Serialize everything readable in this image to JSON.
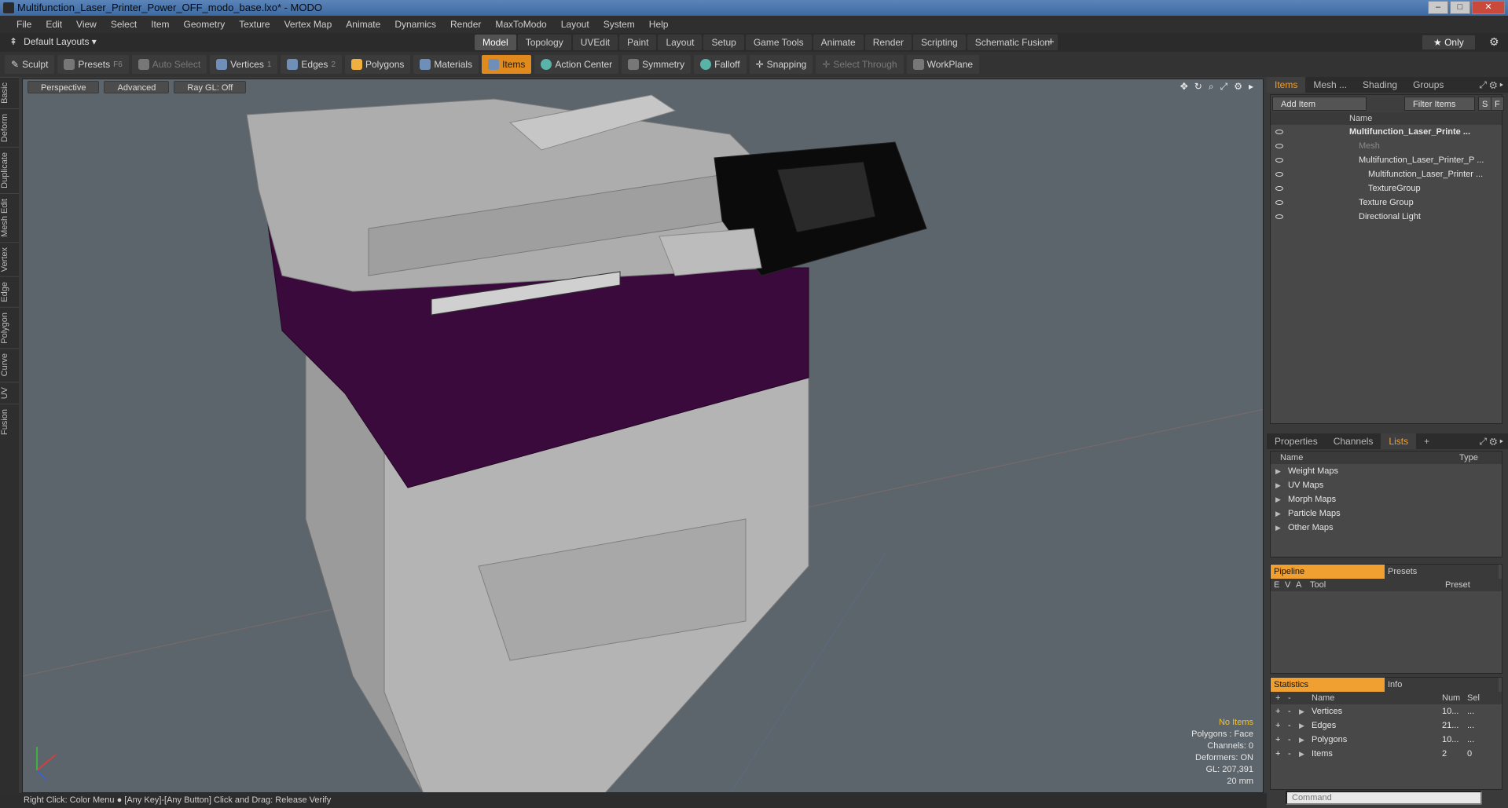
{
  "window": {
    "title": "Multifunction_Laser_Printer_Power_OFF_modo_base.lxo* - MODO",
    "min": "–",
    "max": "□",
    "close": "✕"
  },
  "menubar": [
    "File",
    "Edit",
    "View",
    "Select",
    "Item",
    "Geometry",
    "Texture",
    "Vertex Map",
    "Animate",
    "Dynamics",
    "Render",
    "MaxToModo",
    "Layout",
    "System",
    "Help"
  ],
  "layoutbar": {
    "layouts_label": "Default Layouts ▾",
    "tabs": [
      "Model",
      "Topology",
      "UVEdit",
      "Paint",
      "Layout",
      "Setup",
      "Game Tools",
      "Animate",
      "Render",
      "Scripting",
      "Schematic Fusion"
    ],
    "active_tab": "Model",
    "plus": "+",
    "only": "★ Only"
  },
  "toolbar": {
    "sculpt": "Sculpt",
    "presets": "Presets",
    "presets_key": "F6",
    "auto_select": "Auto Select",
    "vertices": "Vertices",
    "vertices_key": "1",
    "edges": "Edges",
    "edges_key": "2",
    "polygons": "Polygons",
    "materials": "Materials",
    "items": "Items",
    "action_center": "Action Center",
    "symmetry": "Symmetry",
    "falloff": "Falloff",
    "snapping": "Snapping",
    "select_through": "Select Through",
    "workplane": "WorkPlane"
  },
  "leftstrip": [
    "Basic",
    "Deform",
    "Duplicate",
    "Mesh Edit",
    "Vertex",
    "Edge",
    "Polygon",
    "Curve",
    "UV",
    "Fusion"
  ],
  "viewport": {
    "perspective": "Perspective",
    "advanced": "Advanced",
    "raygl": "Ray GL: Off",
    "stats": {
      "no_items": "No Items",
      "polygons": "Polygons : Face",
      "channels": "Channels: 0",
      "deformers": "Deformers: ON",
      "gl": "GL: 207,391",
      "size": "20 mm"
    }
  },
  "statusbar": "Right Click: Color Menu ● [Any Key]-[Any Button] Click and Drag: Release Verify",
  "items_panel": {
    "tabs": [
      "Items",
      "Mesh ...",
      "Shading",
      "Groups"
    ],
    "add_item": "Add Item",
    "filter_items": "Filter Items",
    "s_btn": "S",
    "f_btn": "F",
    "name_header": "Name",
    "tree": [
      {
        "label": "Multifunction_Laser_Printe ...",
        "bold": true
      },
      {
        "label": "Mesh",
        "dim": true
      },
      {
        "label": "Multifunction_Laser_Printer_P ..."
      },
      {
        "label": "Multifunction_Laser_Printer ..."
      },
      {
        "label": "TextureGroup"
      },
      {
        "label": "Texture Group"
      },
      {
        "label": "Directional Light"
      }
    ]
  },
  "lists_panel": {
    "tabs": [
      "Properties",
      "Channels",
      "Lists"
    ],
    "plus": "+",
    "name_header": "Name",
    "type_header": "Type",
    "rows": [
      "Weight Maps",
      "UV Maps",
      "Morph Maps",
      "Particle Maps",
      "Other Maps"
    ]
  },
  "pipeline_panel": {
    "tabs": [
      "Pipeline",
      "Presets"
    ],
    "headers": [
      "E",
      "V",
      "A",
      "Tool",
      "Preset"
    ]
  },
  "stats_panel": {
    "tabs": [
      "Statistics",
      "Info"
    ],
    "headers": [
      "Name",
      "Num",
      "Sel"
    ],
    "rows": [
      {
        "name": "Vertices",
        "num": "10...",
        "sel": "..."
      },
      {
        "name": "Edges",
        "num": "21...",
        "sel": "..."
      },
      {
        "name": "Polygons",
        "num": "10...",
        "sel": "..."
      },
      {
        "name": "Items",
        "num": "2",
        "sel": "0"
      }
    ]
  },
  "command": {
    "placeholder": "Command"
  }
}
